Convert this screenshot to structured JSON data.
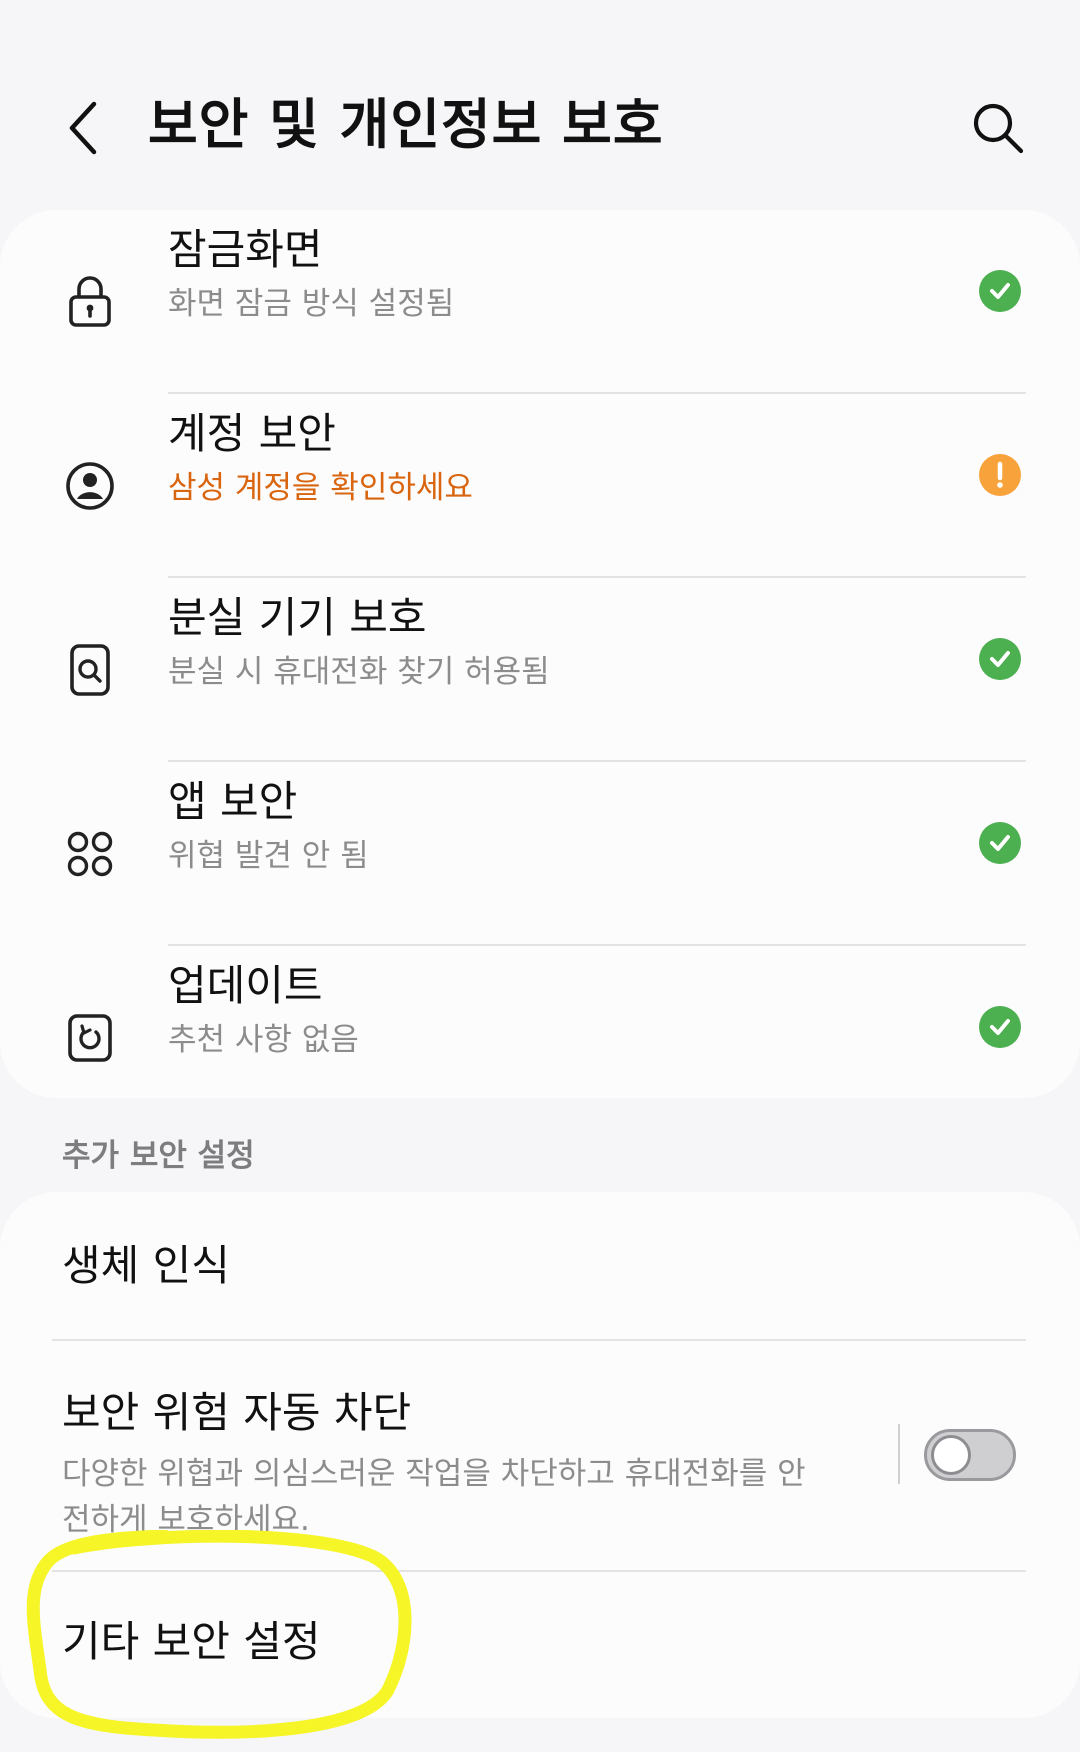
{
  "header": {
    "back_icon": "chevron-left-icon",
    "title": "보안 및 개인정보 보호",
    "search_icon": "search-icon"
  },
  "status_items": [
    {
      "icon": "lock-icon",
      "title": "잠금화면",
      "subtitle": "화면 잠금 방식 설정됨",
      "status": "ok"
    },
    {
      "icon": "account-circle-icon",
      "title": "계정 보안",
      "subtitle": "삼성 계정을 확인하세요",
      "status": "warning"
    },
    {
      "icon": "find-device-icon",
      "title": "분실 기기 보호",
      "subtitle": "분실 시 휴대전화 찾기 허용됨",
      "status": "ok"
    },
    {
      "icon": "apps-icon",
      "title": "앱 보안",
      "subtitle": "위협 발견 안 됨",
      "status": "ok"
    },
    {
      "icon": "update-icon",
      "title": "업데이트",
      "subtitle": "추천 사항 없음",
      "status": "ok"
    }
  ],
  "colors": {
    "ok": "#4caf50",
    "warning": "#f7a23b",
    "warning_text": "#d9650f",
    "highlight": "#f5f528"
  },
  "extra_section": {
    "header": "추가 보안 설정",
    "biometrics_label": "생체 인식",
    "auto_blocker": {
      "title": "보안 위험 자동 차단",
      "subtitle": "다양한 위협과 의심스러운 작업을 차단하고 휴대전화를 안전하게 보호하세요.",
      "toggle_state": "off"
    },
    "other_settings_label": "기타 보안 설정"
  }
}
